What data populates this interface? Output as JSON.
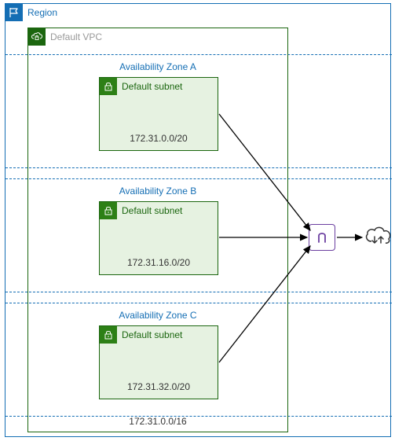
{
  "region": {
    "label": "Region"
  },
  "vpc": {
    "label": "Default VPC",
    "cidr": "172.31.0.0/16"
  },
  "azs": [
    {
      "label": "Availability Zone A",
      "subnet_label": "Default subnet",
      "cidr": "172.31.0.0/20"
    },
    {
      "label": "Availability Zone B",
      "subnet_label": "Default subnet",
      "cidr": "172.31.16.0/20"
    },
    {
      "label": "Availability Zone C",
      "subnet_label": "Default subnet",
      "cidr": "172.31.32.0/20"
    }
  ]
}
